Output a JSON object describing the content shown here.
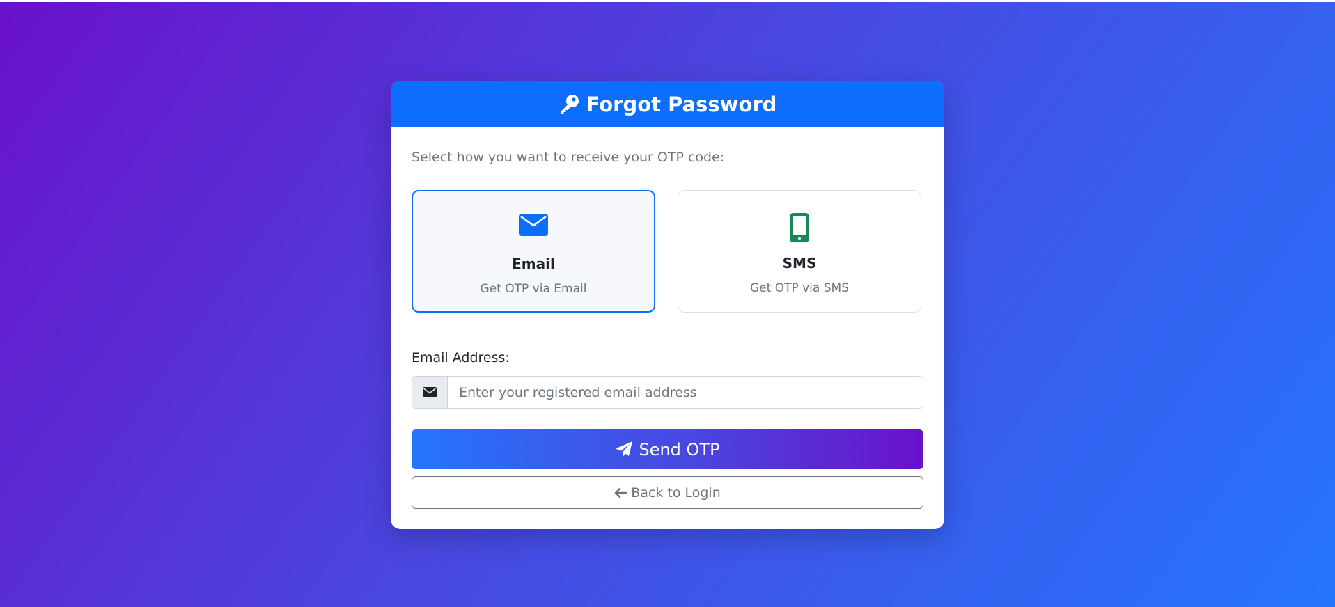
{
  "header": {
    "title": "Forgot Password",
    "icon": "key-icon"
  },
  "intro_text": "Select how you want to receive your OTP code:",
  "methods": [
    {
      "title": "Email",
      "description": "Get OTP via Email",
      "icon": "envelope-icon",
      "selected": true,
      "color": "#0d6efd"
    },
    {
      "title": "SMS",
      "description": "Get OTP via SMS",
      "icon": "mobile-icon",
      "selected": false,
      "color": "#198754"
    }
  ],
  "email_field": {
    "label": "Email Address:",
    "placeholder": "Enter your registered email address",
    "value": "",
    "icon": "envelope-icon"
  },
  "buttons": {
    "send_label": "Send OTP",
    "send_icon": "paper-plane-icon",
    "back_label": "Back to Login",
    "back_icon": "arrow-left-icon"
  },
  "colors": {
    "primary": "#0d6efd",
    "gradient_start": "#2575fc",
    "gradient_end": "#6a11cb",
    "sms_green": "#198754"
  }
}
